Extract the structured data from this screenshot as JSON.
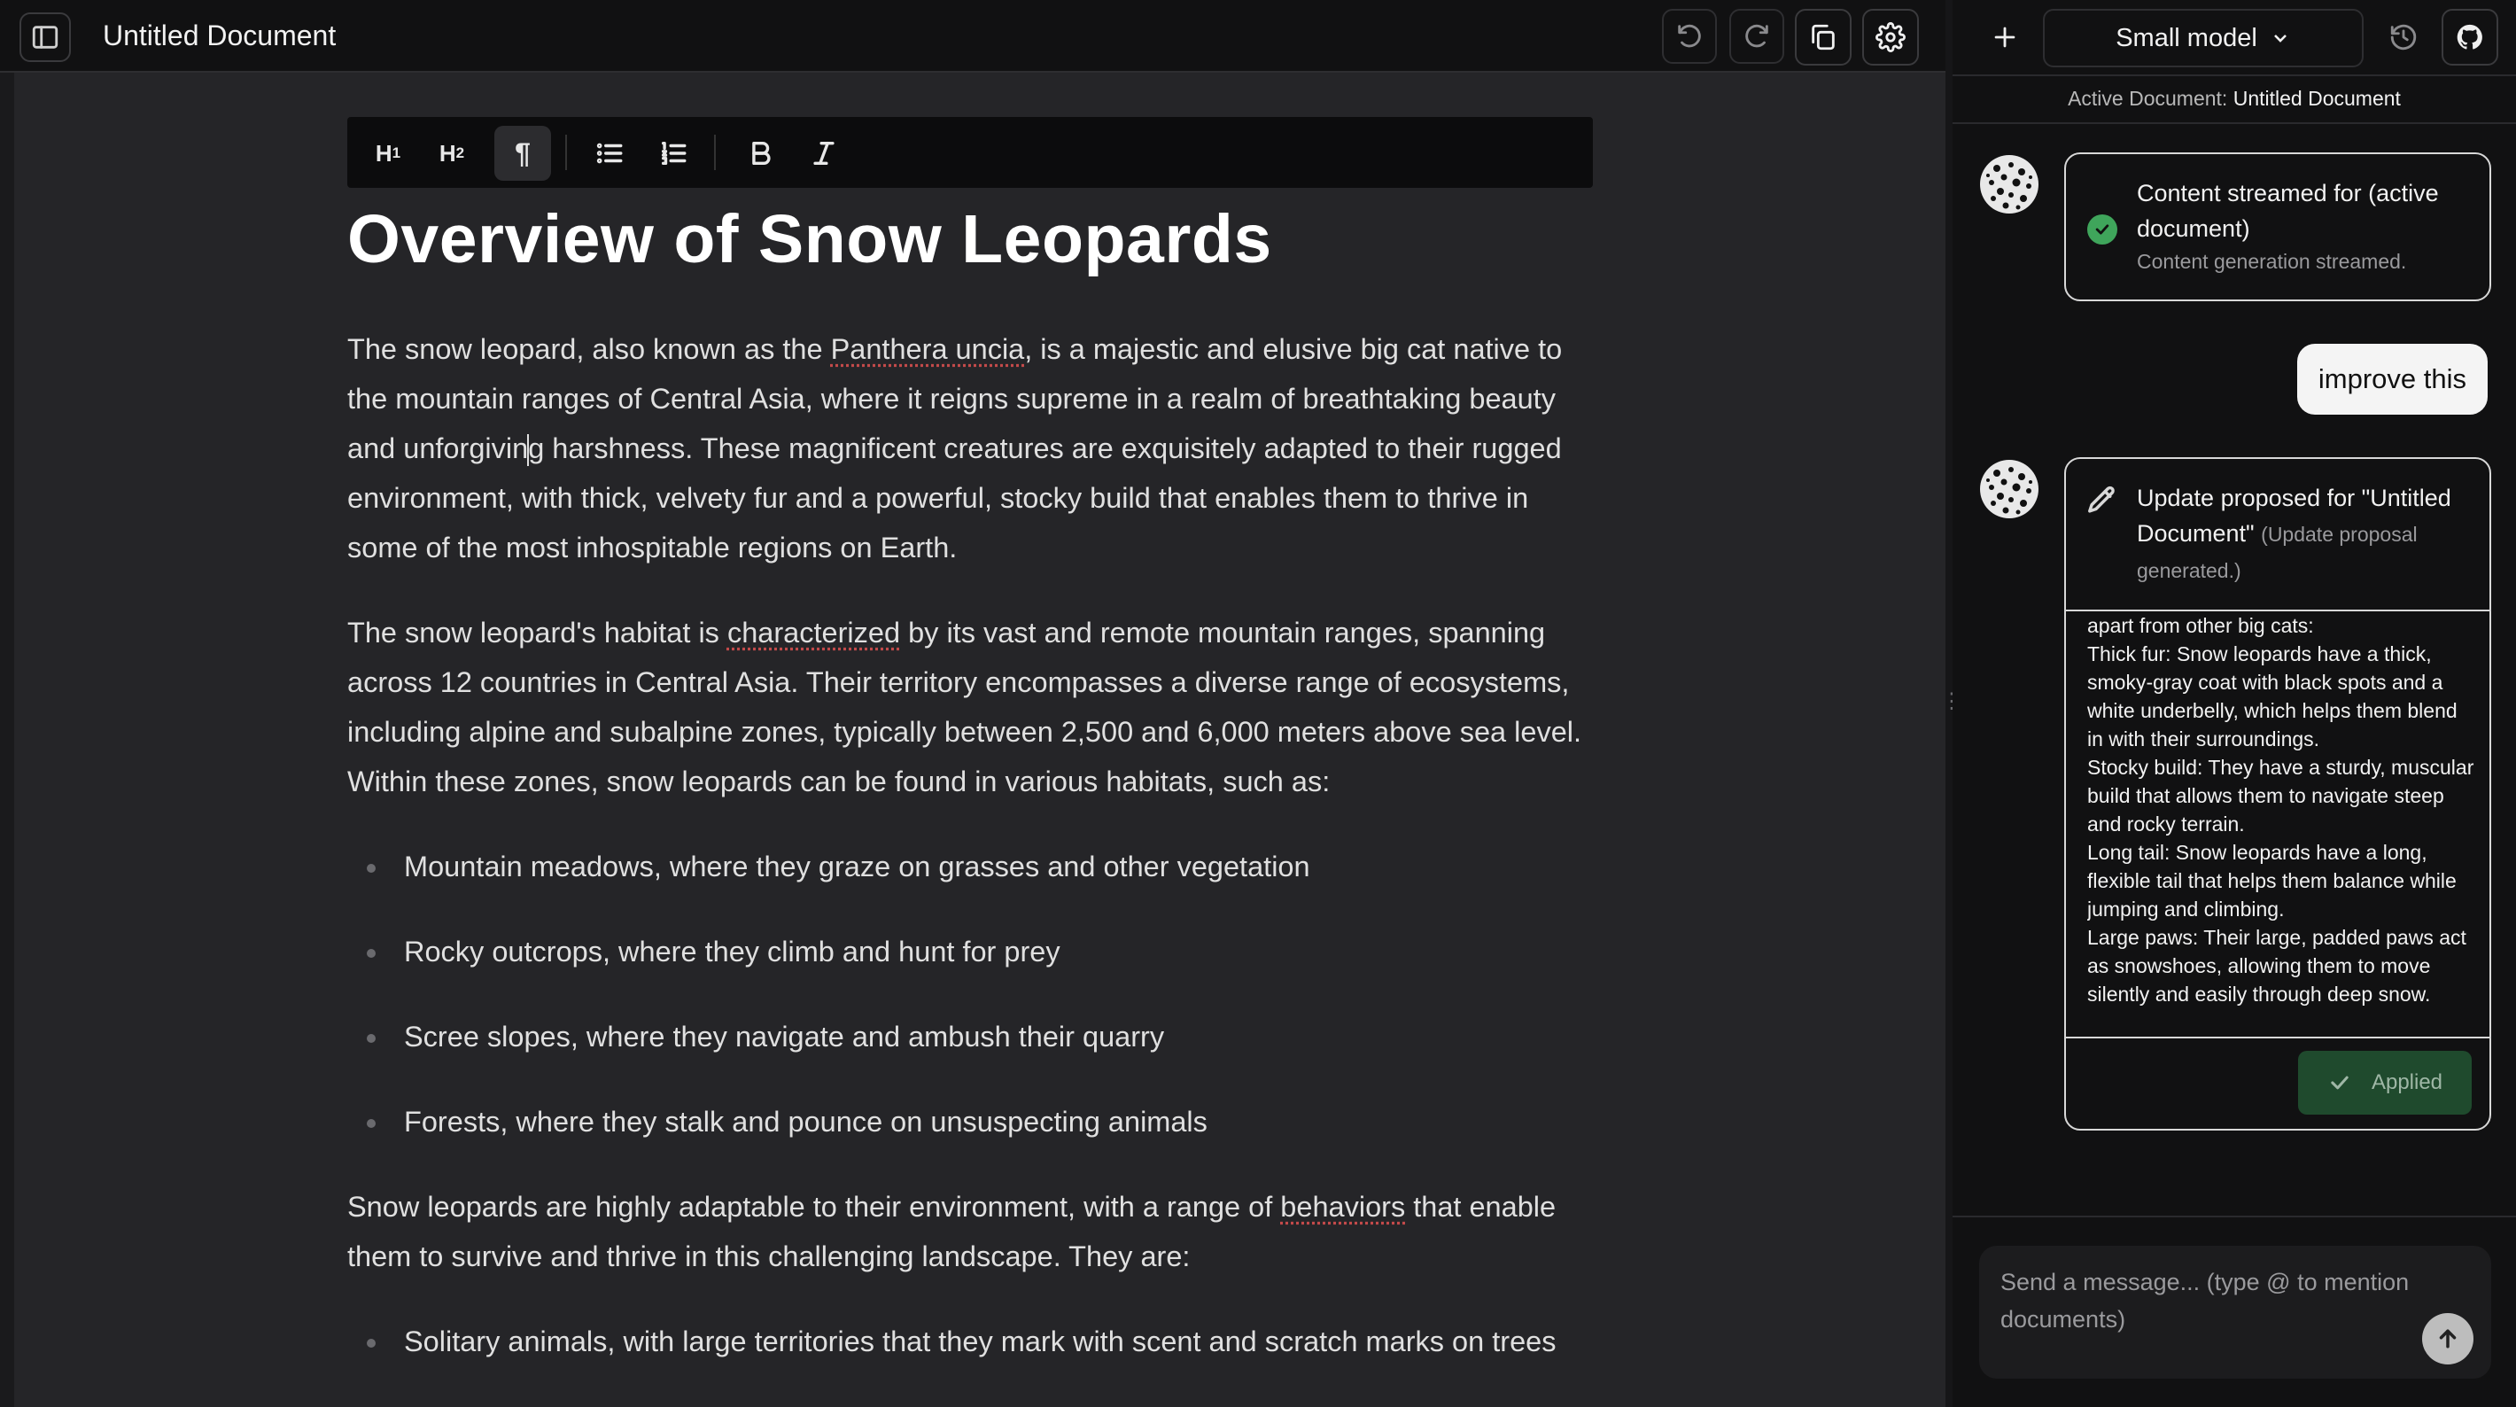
{
  "app": {
    "document_title": "Untitled Document"
  },
  "toolbar": {
    "h1_label": "H",
    "h1_sub": "1",
    "h2_label": "H",
    "h2_sub": "2",
    "paragraph_label": "¶",
    "icons": [
      "sidebar-icon",
      "undo-icon",
      "redo-icon",
      "copy-icon",
      "gear-icon",
      "bullet-list-icon",
      "numbered-list-icon",
      "bold-icon",
      "italic-icon"
    ]
  },
  "document": {
    "heading": "Overview of Snow Leopards",
    "p1_before": "The snow leopard, also known as the ",
    "p1_term": "Panthera uncia",
    "p1_mid": ", is a majestic and elusive big cat native to the mountain ranges of Central Asia, where it reigns supreme in a realm of breathtaking beauty and unforgivin",
    "p1_after": "g harshness. These magnificent creatures are exquisitely adapted to their rugged environment, with thick, velvety fur and a powerful, stocky build that enables them to thrive in some of the most inhospitable regions on Earth.",
    "p2_before": "The snow leopard's habitat is ",
    "p2_term": "characterized",
    "p2_after": " by its vast and remote mountain ranges, spanning across 12 countries in Central Asia. Their territory encompasses a diverse range of ecosystems, including alpine and subalpine zones, typically between 2,500 and 6,000 meters above sea level. Within these zones, snow leopards can be found in various habitats, such as:",
    "habitats": [
      "Mountain meadows, where they graze on grasses and other vegetation",
      "Rocky outcrops, where they climb and hunt for prey",
      "Scree slopes, where they navigate and ambush their quarry",
      "Forests, where they stalk and pounce on unsuspecting animals"
    ],
    "p3_before": "Snow leopards are highly adaptable to their environment, with a range of ",
    "p3_term": "behaviors",
    "p3_after": " that enable them to survive and thrive in this challenging landscape. They are:",
    "traits": [
      "Solitary animals, with large territories that they mark with scent and scratch marks on trees"
    ]
  },
  "chat": {
    "new_chat_icon": "plus-icon",
    "model": "Small model",
    "history_icon": "history-icon",
    "github_icon": "github-icon",
    "active_doc_label": "Active Document:",
    "active_doc_name": "Untitled Document",
    "msg1_title": "Content streamed for (active document)",
    "msg1_sub": "Content generation streamed.",
    "user_msg": "improve this",
    "msg2_title": "Update proposed for \"Untitled Document\"",
    "msg2_sub": "(Update proposal generated.)",
    "msg2_body": "apart from other big cats:\nThick fur: Snow leopards have a thick, smoky-gray coat with black spots and a white underbelly, which helps them blend in with their surroundings.\nStocky build: They have a sturdy, muscular build that allows them to navigate steep and rocky terrain.\nLong tail: Snow leopards have a long, flexible tail that helps them balance while jumping and climbing.\nLarge paws: Their large, padded paws act as snowshoes, allowing them to move silently and easily through deep snow.",
    "applied_label": "Applied",
    "composer_placeholder": "Send a message... (type @ to mention documents)"
  },
  "colors": {
    "success": "#3fa55b",
    "applied_bg": "#1f4a2d",
    "spellcheck": "#c24a4a"
  }
}
